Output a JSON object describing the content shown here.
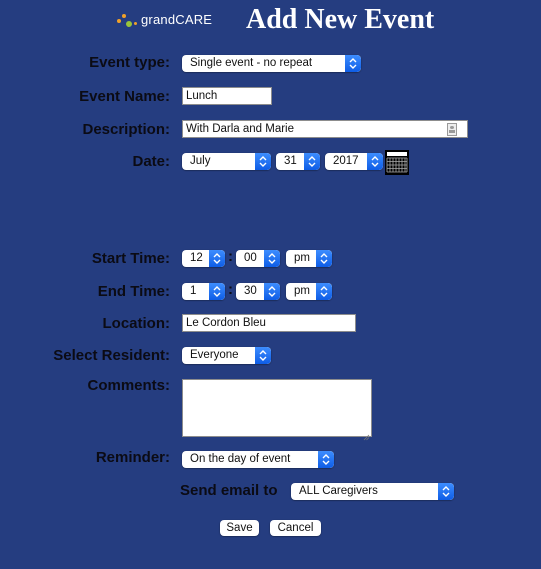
{
  "header": {
    "logo_prefix": "grand",
    "logo_suffix": "CARE",
    "title": "Add New Event",
    "logo_dot_colors": [
      "#f0a12a",
      "#9ac43a",
      "#7cb342",
      "#f0a12a"
    ]
  },
  "form": {
    "event_type": {
      "label": "Event type:",
      "value": "Single event - no repeat"
    },
    "event_name": {
      "label": "Event Name:",
      "value": "Lunch"
    },
    "description": {
      "label": "Description:",
      "value": "With Darla and Marie"
    },
    "date": {
      "label": "Date:",
      "month": "July",
      "day": "31",
      "year": "2017"
    },
    "start_time": {
      "label": "Start Time:",
      "hour": "12",
      "minute": "00",
      "ampm": "pm",
      "separator": ":"
    },
    "end_time": {
      "label": "End Time:",
      "hour": "1",
      "minute": "30",
      "ampm": "pm",
      "separator": ":"
    },
    "location": {
      "label": "Location:",
      "value": "Le Cordon Bleu"
    },
    "resident": {
      "label": "Select Resident:",
      "value": "Everyone"
    },
    "comments": {
      "label": "Comments:",
      "value": ""
    },
    "reminder": {
      "label": "Reminder:",
      "value": "On the day of event"
    },
    "send_email": {
      "label": "Send email to",
      "value": "ALL Caregivers"
    }
  },
  "buttons": {
    "save": "Save",
    "cancel": "Cancel"
  },
  "colors": {
    "background": "#253d80",
    "select_accent": "#1f6ff2"
  }
}
